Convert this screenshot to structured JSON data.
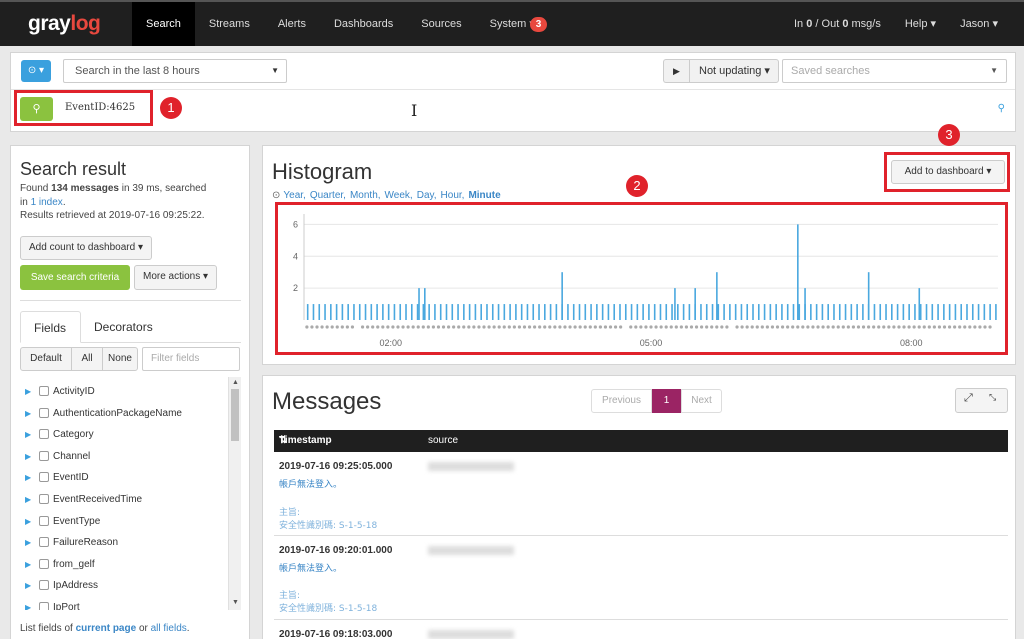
{
  "navbar": {
    "brand_part1": "gray",
    "brand_part2": "log",
    "items": [
      "Search",
      "Streams",
      "Alerts",
      "Dashboards",
      "Sources",
      "System ▾"
    ],
    "notification_count": "3",
    "throughput_prefix": "In ",
    "throughput_in": "0",
    "throughput_mid": " / Out ",
    "throughput_out": "0",
    "throughput_suffix": " msg/s",
    "help": "Help ▾",
    "user": "Jason ▾"
  },
  "search": {
    "range_label": "Search in the last 8 hours",
    "not_updating": "Not updating ▾",
    "saved_searches_placeholder": "Saved searches",
    "query": "EventID:4625"
  },
  "annotations": [
    "1",
    "2",
    "3"
  ],
  "colors": {
    "accent_red": "#e0222b",
    "green": "#8bc23f",
    "blue": "#3aa0de",
    "pager_active": "#9b2464"
  },
  "search_result": {
    "title": "Search result",
    "found_prefix": "Found ",
    "found_count": "134 messages",
    "found_suffix": " in 39 ms, searched",
    "in_word": "in ",
    "index_link": "1 index",
    "index_suffix": ".",
    "retrieved": "Results retrieved at 2019-07-16 09:25:22.",
    "add_count_button": "Add count to dashboard ▾",
    "save_button": "Save search criteria",
    "more_actions": "More actions ▾",
    "tabs": [
      "Fields",
      "Decorators"
    ],
    "filter_buttons": [
      "Default",
      "All",
      "None"
    ],
    "filter_placeholder": "Filter fields",
    "fields": [
      "ActivityID",
      "AuthenticationPackageName",
      "Category",
      "Channel",
      "EventID",
      "EventReceivedTime",
      "EventType",
      "FailureReason",
      "from_gelf",
      "IpAddress",
      "IpPort"
    ],
    "footer_prefix": "List fields of ",
    "footer_link1": "current page",
    "footer_mid": " or ",
    "footer_link2": "all fields",
    "footer_suffix": "."
  },
  "histogram": {
    "title": "Histogram",
    "resolutions": [
      "Year,",
      "Quarter,",
      "Month,",
      "Week,",
      "Day,",
      "Hour,",
      "Minute"
    ],
    "add_to_dashboard": "Add to dashboard ▾"
  },
  "chart_data": {
    "type": "bar",
    "y_ticks": [
      "6",
      "4",
      "2"
    ],
    "ylim": [
      0,
      6.4
    ],
    "x_ticks": [
      "02:00",
      "05:00",
      "08:00"
    ],
    "x_tick_positions": [
      60,
      240,
      420
    ],
    "x_range": [
      0,
      480
    ],
    "series": [
      {
        "values": [
          1,
          1,
          1,
          1,
          1,
          1,
          1,
          1,
          1,
          1,
          1,
          1,
          1,
          1,
          1,
          1,
          1,
          1,
          1,
          1,
          1,
          1,
          1,
          1,
          1,
          1,
          1,
          1,
          1,
          1,
          1,
          1,
          1,
          1,
          1,
          1,
          1,
          1,
          1,
          1,
          1,
          1,
          1,
          1,
          1,
          1,
          1,
          1,
          1,
          1,
          1,
          1,
          1,
          1,
          1,
          1,
          1,
          1,
          1,
          1,
          1,
          2,
          1,
          1,
          1,
          2,
          1,
          1,
          1,
          1,
          1,
          1,
          1,
          1,
          1,
          1,
          1,
          1,
          1,
          1,
          1,
          1,
          1,
          1,
          1,
          1,
          1,
          1,
          1,
          1,
          1,
          1,
          1,
          1,
          1,
          1,
          1,
          1,
          1,
          1,
          1,
          1,
          1,
          1,
          1,
          1,
          1,
          1,
          1,
          1,
          1,
          1,
          1,
          1,
          1,
          1,
          1,
          1,
          1,
          1,
          1,
          1,
          1,
          1,
          1,
          1,
          1,
          1,
          1,
          1,
          1,
          1,
          1,
          1,
          1,
          1,
          1,
          1,
          1,
          1,
          1,
          1,
          1,
          1,
          1,
          1,
          1,
          1,
          1,
          1,
          1,
          1,
          1,
          1,
          1,
          1,
          1,
          1,
          1,
          1,
          1,
          1,
          1,
          1,
          1,
          1,
          1,
          1,
          1,
          1,
          1,
          1,
          1,
          1,
          1,
          1,
          1,
          1,
          1,
          1,
          1,
          1,
          1,
          1,
          1,
          1,
          1,
          1,
          1,
          1,
          1,
          1,
          1,
          1,
          1,
          1,
          1,
          1,
          1,
          1,
          1,
          1,
          1,
          1,
          1,
          1,
          1,
          1,
          1,
          1,
          1,
          1,
          1,
          1,
          1,
          1,
          1,
          1,
          1,
          1,
          1,
          1,
          1,
          1,
          1,
          1,
          1,
          1,
          1,
          1,
          1,
          1,
          1,
          1,
          1,
          1,
          1,
          1,
          1,
          1,
          1,
          1,
          1,
          1,
          1,
          1,
          1,
          1,
          1,
          1,
          1,
          1,
          1,
          1,
          1,
          1,
          1,
          1,
          1,
          1,
          1,
          1,
          1,
          1,
          1,
          1,
          1,
          1,
          1,
          1,
          1,
          1,
          1,
          1,
          1,
          1,
          1,
          1,
          1,
          1,
          1,
          1,
          1,
          1,
          1,
          1,
          1,
          1,
          1,
          1,
          1,
          1,
          1,
          1,
          1,
          1,
          1,
          1,
          1,
          1,
          1,
          1,
          1,
          1,
          1,
          1,
          1,
          1,
          1,
          1,
          1,
          1,
          1,
          1,
          1,
          1,
          1,
          1,
          1,
          1,
          1,
          1,
          1,
          1,
          1,
          1,
          1,
          1,
          1,
          1,
          1,
          1,
          1,
          1,
          1,
          1,
          1,
          1,
          1,
          1,
          1,
          1,
          1,
          1,
          1,
          1,
          1,
          1,
          1,
          1,
          1,
          1,
          1,
          1,
          1,
          1,
          1,
          1,
          1,
          1,
          1,
          1,
          1,
          1,
          1,
          1,
          1,
          1,
          1,
          1,
          1,
          1,
          1,
          1,
          1,
          1,
          1,
          1,
          1,
          1,
          1,
          1,
          1,
          1,
          1,
          1,
          1,
          1,
          1,
          1,
          1,
          1,
          1,
          1,
          1,
          1,
          1,
          1,
          1,
          1,
          1,
          1,
          1,
          1,
          1,
          1,
          1,
          1,
          1,
          1,
          1,
          1,
          1,
          1,
          1,
          1,
          1,
          1,
          1,
          1,
          1,
          1,
          1,
          1,
          1,
          1,
          1,
          1,
          1,
          1,
          1,
          1,
          1,
          1,
          1,
          1,
          1,
          1,
          1,
          1,
          1,
          1,
          1,
          1,
          1,
          1,
          1,
          1,
          1,
          1,
          1,
          1,
          1,
          1,
          1,
          1,
          1,
          1,
          1,
          1,
          1,
          1,
          1,
          1,
          1,
          1,
          1,
          1,
          1,
          1,
          1,
          1,
          1,
          1,
          1,
          1,
          1,
          1,
          1,
          1,
          1,
          1,
          1,
          1,
          1,
          1,
          1,
          1,
          1,
          1,
          1,
          1,
          1,
          1,
          1,
          1,
          1,
          1,
          1,
          1,
          1,
          1
        ],
        "color": "#4aa8df"
      }
    ],
    "bar_minutes": [
      2,
      6,
      10,
      14,
      18,
      22,
      26,
      30,
      34,
      38,
      42,
      46,
      50,
      54,
      58,
      62,
      66,
      70,
      74,
      78,
      82,
      86,
      90,
      94,
      98,
      102,
      106,
      110,
      114,
      118,
      122,
      126,
      130,
      134,
      138,
      142,
      146,
      150,
      154,
      158,
      162,
      166,
      170,
      174,
      178,
      182,
      186,
      190,
      194,
      198,
      202,
      206,
      210,
      214,
      218,
      222,
      226,
      230,
      234,
      238,
      242,
      246,
      250,
      254,
      258,
      262,
      266,
      270,
      274,
      278,
      282,
      286,
      290,
      294,
      298,
      302,
      306,
      310,
      314,
      318,
      322,
      326,
      330,
      334,
      338,
      342,
      346,
      350,
      354,
      358,
      362,
      366,
      370,
      374,
      378,
      382,
      386,
      390,
      394,
      398,
      402,
      406,
      410,
      414,
      418,
      422,
      426,
      430,
      434,
      438,
      442,
      446,
      450,
      454,
      458,
      462,
      466,
      470,
      474,
      478
    ],
    "bar_values": [
      1,
      1,
      1,
      1,
      1,
      1,
      1,
      1,
      1,
      1,
      1,
      1,
      1,
      1,
      1,
      1,
      1,
      1,
      1,
      1,
      1,
      1,
      1,
      1,
      1,
      1,
      1,
      1,
      1,
      1,
      1,
      1,
      1,
      1,
      1,
      1,
      1,
      1,
      1,
      1,
      1,
      1,
      1,
      1,
      1,
      1,
      1,
      1,
      1,
      1,
      1,
      1,
      1,
      1,
      1,
      1,
      1,
      1,
      1,
      1,
      1,
      1,
      1,
      1,
      1,
      1,
      1,
      1,
      1,
      1,
      1,
      1,
      1,
      1,
      1,
      1,
      1,
      1,
      1,
      1,
      1,
      1,
      1,
      1,
      1,
      1,
      1,
      1,
      1,
      1,
      1,
      1,
      1,
      1,
      1,
      1,
      1,
      1,
      1,
      1,
      1,
      1,
      1,
      1,
      1,
      1,
      1,
      1,
      1,
      1,
      1,
      1,
      1,
      1,
      1,
      1,
      1,
      1,
      1,
      1
    ],
    "spikes": [
      [
        79,
        2
      ],
      [
        83,
        2
      ],
      [
        178,
        3
      ],
      [
        256,
        2
      ],
      [
        270,
        2
      ],
      [
        285,
        3
      ],
      [
        341,
        6
      ],
      [
        346,
        2
      ],
      [
        390,
        3
      ],
      [
        425,
        2
      ]
    ]
  },
  "messages": {
    "title": "Messages",
    "pager": [
      "Previous",
      "1",
      "Next"
    ],
    "columns": [
      "Timestamp",
      "source"
    ],
    "rows": [
      {
        "timestamp": "2019-07-16 09:25:05.000",
        "line1": "帳戶無法登入。",
        "line2": "主旨:",
        "line3": "安全性識別碼:  S-1-5-18"
      },
      {
        "timestamp": "2019-07-16 09:20:01.000",
        "line1": "帳戶無法登入。",
        "line2": "主旨:",
        "line3": "安全性識別碼:  S-1-5-18"
      },
      {
        "timestamp": "2019-07-16 09:18:03.000",
        "line1": "",
        "line2": "",
        "line3": ""
      }
    ]
  }
}
